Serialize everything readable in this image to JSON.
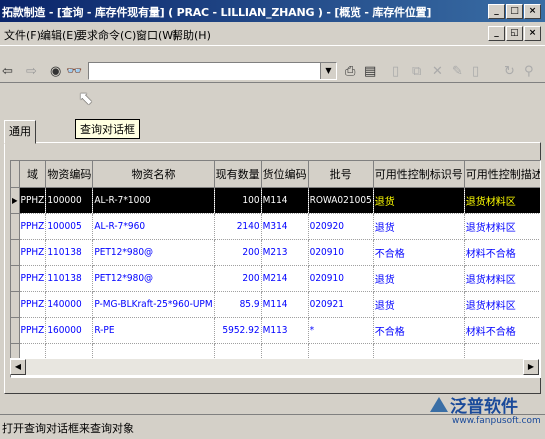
{
  "window": {
    "title": "拓款制造 - [查询 - 库存件现有量] ( PRAC - LILLIAN_ZHANG ) - [概览 - 库存件位置]"
  },
  "menu": [
    {
      "label": "文件(F)"
    },
    {
      "label": "编辑(E)"
    },
    {
      "label": "要求命令(C)"
    },
    {
      "label": "窗口(W)"
    },
    {
      "label": "帮助(H)"
    }
  ],
  "tooltip": "查询对话框",
  "tab_label": "通用",
  "columns": [
    "域",
    "物资编码",
    "物资名称",
    "现有数量",
    "货位编码",
    "批号",
    "可用性控制标识号",
    "可用性控制描述"
  ],
  "rows": [
    [
      "PPHZ",
      "100000",
      "AL-R-7*1000",
      "100",
      "M114",
      "ROWA021005",
      "退货",
      "退货材料区"
    ],
    [
      "PPHZ",
      "100005",
      "AL-R-7*960",
      "2140",
      "M314",
      "020920",
      "退货",
      "退货材料区"
    ],
    [
      "PPHZ",
      "110138",
      "PET12*980@",
      "200",
      "M213",
      "020910",
      "不合格",
      "材料不合格"
    ],
    [
      "PPHZ",
      "110138",
      "PET12*980@",
      "200",
      "M214",
      "020910",
      "退货",
      "退货材料区"
    ],
    [
      "PPHZ",
      "140000",
      "P-MG-BLKraft-25*960-UPM",
      "85.9",
      "M114",
      "020921",
      "退货",
      "退货材料区"
    ],
    [
      "PPHZ",
      "160000",
      "R-PE",
      "5952.92",
      "M113",
      "*",
      "不合格",
      "材料不合格"
    ]
  ],
  "status": "打开查询对话框来查询对象",
  "logo": {
    "name": "泛普软件",
    "url": "www.fanpusoft.com"
  }
}
